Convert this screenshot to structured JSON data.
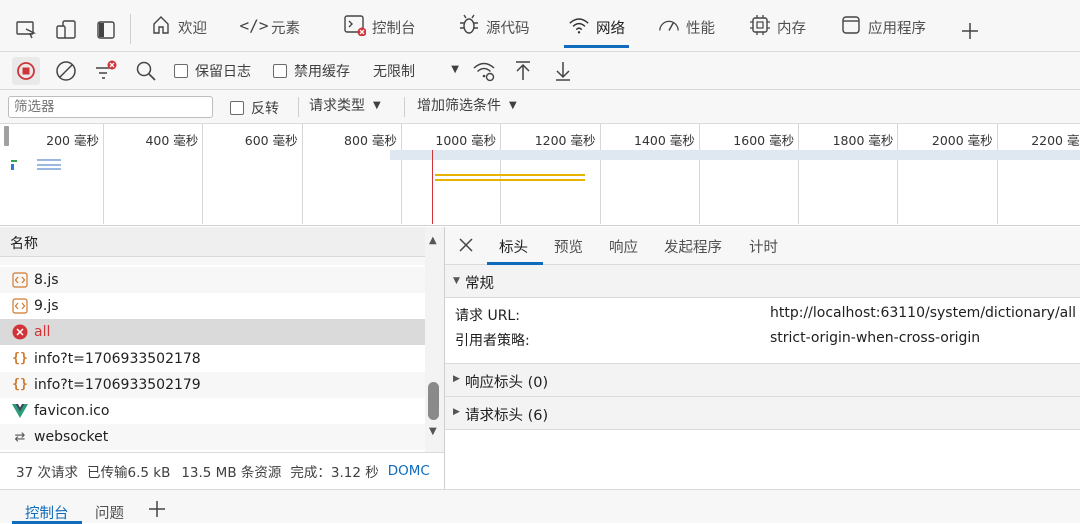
{
  "tabs": [
    {
      "label": "欢迎",
      "icon": "home-icon"
    },
    {
      "label": "元素",
      "icon": "code-icon"
    },
    {
      "label": "控制台",
      "icon": "console-icon"
    },
    {
      "label": "源代码",
      "icon": "bug-icon"
    },
    {
      "label": "网络",
      "icon": "wifi-icon"
    },
    {
      "label": "性能",
      "icon": "performance-icon"
    },
    {
      "label": "内存",
      "icon": "chip-icon"
    },
    {
      "label": "应用程序",
      "icon": "app-icon"
    }
  ],
  "toolbar": {
    "preserve_log": "保留日志",
    "disable_cache": "禁用缓存",
    "throttle": "无限制"
  },
  "filterbar": {
    "placeholder": "筛选器",
    "invert": "反转",
    "request_type": "请求类型",
    "more_filters": "增加筛选条件"
  },
  "overview": {
    "ticks": [
      "200 毫秒",
      "400 毫秒",
      "600 毫秒",
      "800 毫秒",
      "1000 毫秒",
      "1200 毫秒",
      "1400 毫秒",
      "1600 毫秒",
      "1800 毫秒",
      "2000 毫秒",
      "2200 毫秒"
    ]
  },
  "list": {
    "header": "名称",
    "rows": [
      {
        "name": "8.js",
        "type": "script",
        "error": false,
        "selected": false
      },
      {
        "name": "9.js",
        "type": "script",
        "error": false,
        "selected": false
      },
      {
        "name": "all",
        "type": "error",
        "error": true,
        "selected": true
      },
      {
        "name": "info?t=1706933502178",
        "type": "fetch",
        "error": false,
        "selected": false
      },
      {
        "name": "info?t=1706933502179",
        "type": "fetch",
        "error": false,
        "selected": false
      },
      {
        "name": "favicon.ico",
        "type": "vue",
        "error": false,
        "selected": false
      },
      {
        "name": "websocket",
        "type": "websocket",
        "error": false,
        "selected": false
      }
    ]
  },
  "status": {
    "requests": "37 次请求",
    "transferred": "已传输6.5 kB",
    "resources": "13.5 MB 条资源",
    "finish": "完成：3.12 秒",
    "domcontent": "DOMC"
  },
  "details": {
    "tabs": [
      "标头",
      "预览",
      "响应",
      "发起程序",
      "计时"
    ],
    "general_title": "常规",
    "request_url_label": "请求 URL:",
    "request_url": "http://localhost:63110/system/dictionary/all",
    "referrer_label": "引用者策略:",
    "referrer": "strict-origin-when-cross-origin",
    "response_headers": "响应标头 (0)",
    "request_headers": "请求标头 (6)"
  },
  "drawer": {
    "tabs": [
      "控制台",
      "问题"
    ]
  },
  "colors": {
    "accent": "#0f6cbd",
    "error": "#d13438",
    "selected_row": "#dadada",
    "waterfall_bar": "#e6b400"
  }
}
